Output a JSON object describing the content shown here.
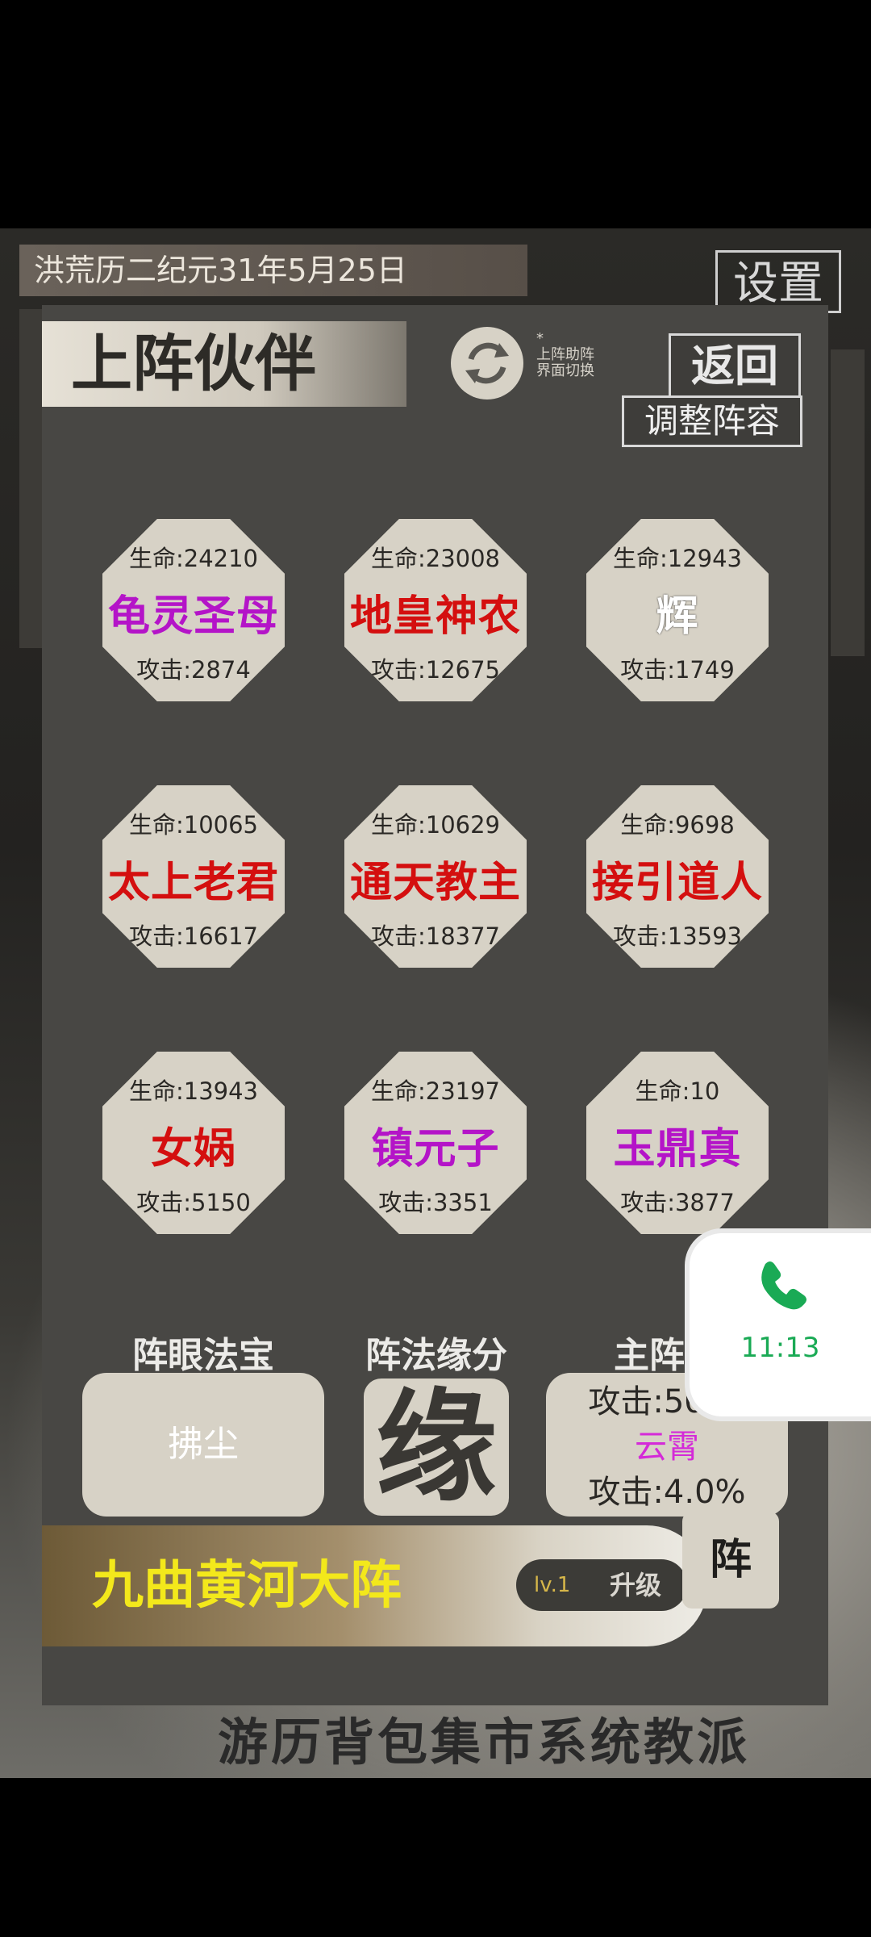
{
  "header": {
    "date": "洪荒历二纪元31年5月25日",
    "settings_label": "设置"
  },
  "panel": {
    "title": "上阵伙伴",
    "switch_note": "*\n上阵助阵\n界面切换",
    "back_label": "返回",
    "adjust_label": "调整阵容"
  },
  "partners": [
    {
      "hp": "生命:24210",
      "name": "龟灵圣母",
      "atk": "攻击:2874",
      "color": "#b414c8"
    },
    {
      "hp": "生命:23008",
      "name": "地皇神农",
      "atk": "攻击:12675",
      "color": "#d40f0f"
    },
    {
      "hp": "生命:12943",
      "name": "辉",
      "atk": "攻击:1749",
      "color": "#ffffff"
    },
    {
      "hp": "生命:10065",
      "name": "太上老君",
      "atk": "攻击:16617",
      "color": "#d40f0f"
    },
    {
      "hp": "生命:10629",
      "name": "通天教主",
      "atk": "攻击:18377",
      "color": "#d40f0f"
    },
    {
      "hp": "生命:9698",
      "name": "接引道人",
      "atk": "攻击:13593",
      "color": "#d40f0f"
    },
    {
      "hp": "生命:13943",
      "name": "女娲",
      "atk": "攻击:5150",
      "color": "#d40f0f"
    },
    {
      "hp": "生命:23197",
      "name": "镇元子",
      "atk": "攻击:3351",
      "color": "#b414c8"
    },
    {
      "hp": "生命:10",
      "name": "玉鼎真",
      "atk": "攻击:3877",
      "color": "#b414c8"
    }
  ],
  "sections": {
    "treasure_label": "阵眼法宝",
    "treasure_item": "拂尘",
    "fate_label": "阵法缘分",
    "fate_char": "缘",
    "leader_label": "主阵人",
    "leader_atk": "攻击:5021",
    "leader_name": "云霄",
    "leader_bonus": "攻击:4.0%"
  },
  "formation": {
    "name": "九曲黄河大阵",
    "level": "lv.1",
    "upgrade_label": "升级",
    "zhen_label": "阵"
  },
  "nav": {
    "tabs": "游历背包集市系统教派"
  },
  "call": {
    "time": "11:13"
  }
}
